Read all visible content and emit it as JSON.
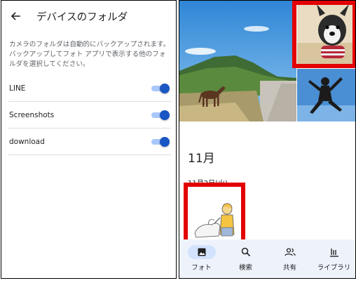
{
  "settings": {
    "title": "デバイスのフォルダ",
    "description": "カメラのフォルダは自動的にバックアップされます。バックアップしてフォト アプリで表示する他のフォルダを選択してください。",
    "folders": [
      {
        "name": "LINE",
        "enabled": true
      },
      {
        "name": "Screenshots",
        "enabled": true
      },
      {
        "name": "download",
        "enabled": true
      }
    ],
    "accent_color": "#1a56c4"
  },
  "photos": {
    "month_label": "11月",
    "date_label": "11月2日(火)"
  },
  "nav": {
    "items": [
      {
        "label": "フォト",
        "icon": "photo-icon",
        "active": true
      },
      {
        "label": "検索",
        "icon": "search-icon",
        "active": false
      },
      {
        "label": "共有",
        "icon": "people-icon",
        "active": false
      },
      {
        "label": "ライブラリ",
        "icon": "library-icon",
        "active": false
      }
    ]
  },
  "highlight_color": "#e30000"
}
